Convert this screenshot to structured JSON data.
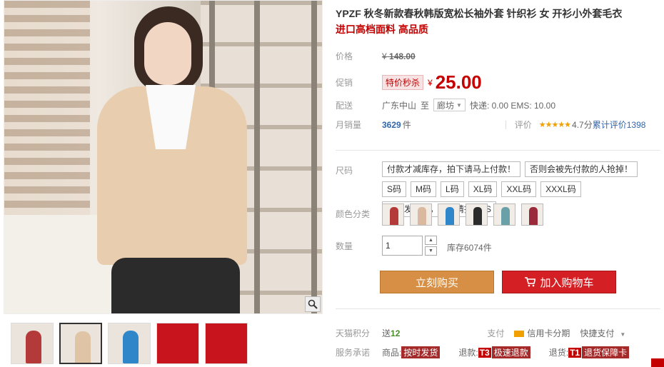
{
  "product": {
    "title": "YPZF 秋冬新款春秋韩版宽松长袖外套 针织衫 女 开衫小外套毛衣",
    "subtitle": "进口高档面料 高品质"
  },
  "price": {
    "label": "价格",
    "currency": "¥",
    "original": "148.00"
  },
  "promo": {
    "label": "促销",
    "tag": "特价秒杀",
    "currency": "¥",
    "price": "25.00"
  },
  "shipping": {
    "label": "配送",
    "from": "广东中山",
    "to_word": "至",
    "to": "廊坊",
    "fees": "快递: 0.00 EMS: 10.00"
  },
  "sales": {
    "label": "月销量",
    "count": "3629",
    "unit": "件",
    "review_label": "评价",
    "stars": "★★★★★",
    "rating": "4.7分",
    "review_link": "累计评价1398"
  },
  "size": {
    "label": "尺码",
    "options": [
      "付款才减库存，拍下请马上付款！",
      "否则会被先付款的人抢掉！",
      "S码",
      "M码",
      "L码",
      "XL码",
      "XXL码",
      "XXXL码",
      "默认发中通，不到请拍EMS"
    ]
  },
  "color": {
    "label": "颜色分类",
    "swatches": [
      "#b43a3a",
      "#d9b9a0",
      "#2f86c8",
      "#2b2b2b",
      "#6aa0a8",
      "#9a2a3a"
    ]
  },
  "quantity": {
    "label": "数量",
    "value": "1",
    "stock": "库存6074件",
    "up": "▲",
    "down": "▼"
  },
  "actions": {
    "buy": "立刻购买",
    "cart": "加入购物车"
  },
  "points": {
    "label": "天猫积分",
    "prefix": "送",
    "value": "12",
    "pay_label": "支付",
    "credit": "信用卡分期",
    "quick": "快捷支付"
  },
  "service": {
    "label": "服务承诺",
    "goods_prefix": "商品:",
    "goods_tag": "按时发货",
    "refund_prefix": "退款:",
    "refund_t": "T3",
    "refund_tag": "极速退款",
    "return_prefix": "退货:",
    "return_t": "T1",
    "return_tag": "退货保障卡"
  },
  "thumbnails": [
    "#b43a3a",
    "#e0c4a6",
    "#2f86c8",
    "#c8141c",
    "#c8141c"
  ],
  "colors": {
    "accent": "#c40000",
    "buy_button": "#d78f45",
    "cart_button": "#d42024"
  }
}
